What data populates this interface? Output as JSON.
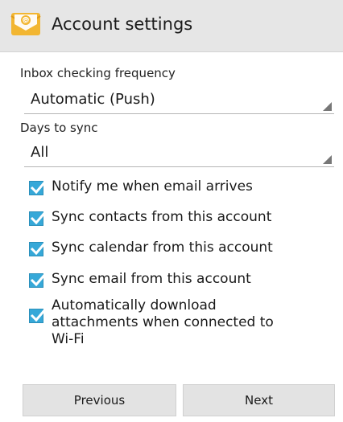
{
  "header": {
    "title": "Account settings",
    "icon": "email-envelope-icon"
  },
  "inbox_frequency": {
    "label": "Inbox checking frequency",
    "value": "Automatic (Push)"
  },
  "days_to_sync": {
    "label": "Days to sync",
    "value": "All"
  },
  "checkboxes": [
    {
      "label": "Notify me when email arrives",
      "checked": true
    },
    {
      "label": "Sync contacts from this account",
      "checked": true
    },
    {
      "label": "Sync calendar from this account",
      "checked": true
    },
    {
      "label": "Sync email from this account",
      "checked": true
    },
    {
      "label": "Automatically download attachments when connected to Wi-Fi",
      "checked": true
    }
  ],
  "buttons": {
    "previous": "Previous",
    "next": "Next"
  },
  "colors": {
    "accent": "#36a8d8",
    "header_bg": "#e6e6e6",
    "button_bg": "#e3e3e3"
  }
}
